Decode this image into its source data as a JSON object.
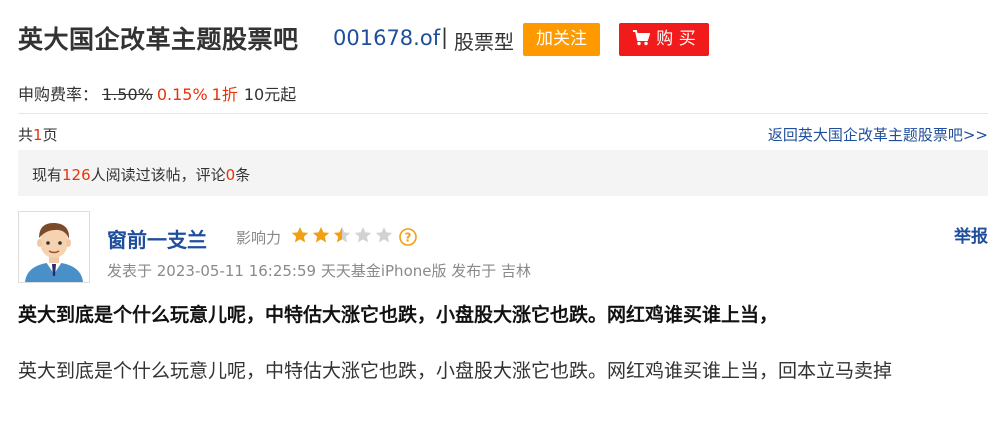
{
  "header": {
    "title": "英大国企改革主题股票吧",
    "fund_code": "001678.of",
    "separator": "|",
    "fund_type": "股票型",
    "follow_label": "加关注",
    "buy_label": "购 买"
  },
  "fee": {
    "label": "申购费率：",
    "original": "1.50%",
    "discounted": "0.15%",
    "discount": "1折",
    "minimum": "10元起"
  },
  "pagination": {
    "prefix": "共",
    "count": "1",
    "suffix": "页",
    "return_link": "返回英大国企改革主题股票吧>>"
  },
  "read_info": {
    "prefix": "现有",
    "read_count": "126",
    "middle": "人阅读过该帖，评论",
    "comment_count": "0",
    "suffix": "条"
  },
  "post": {
    "author": "窗前一支兰",
    "influence_label": "影响力",
    "influence_stars": 2.5,
    "influence_max": 5,
    "report_label": "举报",
    "meta": "发表于 2023-05-11 16:25:59 天天基金iPhone版 发布于 吉林",
    "title": "英大到底是个什么玩意儿呢，中特估大涨它也跌，小盘股大涨它也跌。网红鸡谁买谁上当，",
    "body": "英大到底是个什么玩意儿呢，中特估大涨它也跌，小盘股大涨它也跌。网红鸡谁买谁上当，回本立马卖掉"
  },
  "colors": {
    "link_blue": "#1f4e9c",
    "orange": "#ff9900",
    "red": "#f11b1b",
    "highlight": "#e8320a",
    "star": "#f0a010"
  }
}
